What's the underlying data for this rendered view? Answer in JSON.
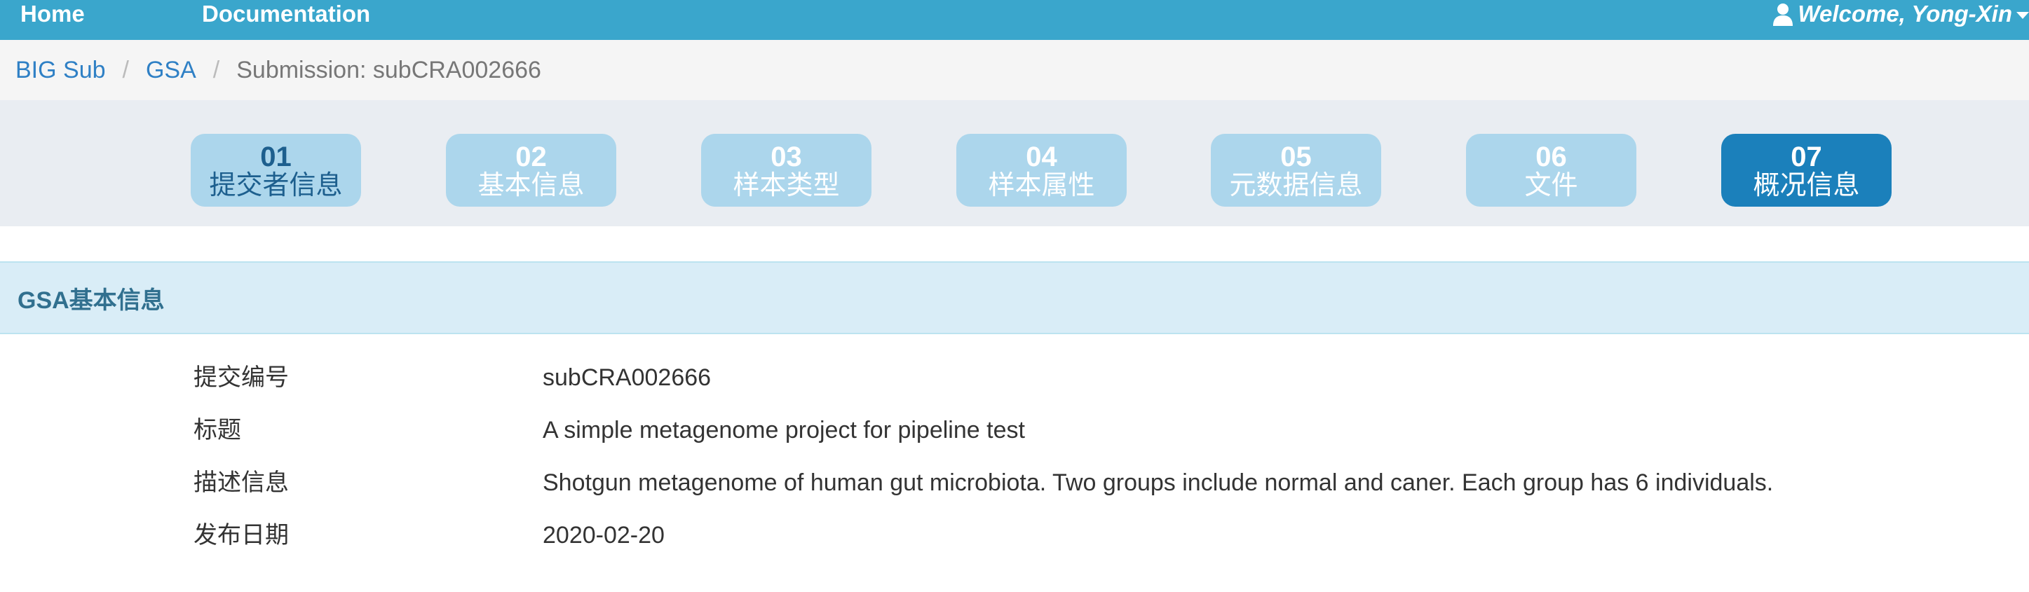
{
  "navbar": {
    "home": "Home",
    "documentation": "Documentation",
    "welcome": "Welcome, Yong-Xin"
  },
  "breadcrumb": {
    "items": [
      "BIG Sub",
      "GSA"
    ],
    "active": "Submission: subCRA002666",
    "separator": "/"
  },
  "steps": [
    {
      "num": "01",
      "label": "提交者信息"
    },
    {
      "num": "02",
      "label": "基本信息"
    },
    {
      "num": "03",
      "label": "样本类型"
    },
    {
      "num": "04",
      "label": "样本属性"
    },
    {
      "num": "05",
      "label": "元数据信息"
    },
    {
      "num": "06",
      "label": "文件"
    },
    {
      "num": "07",
      "label": "概况信息"
    }
  ],
  "active_step": "07",
  "panel": {
    "title": "GSA基本信息"
  },
  "info": [
    {
      "label": "提交编号",
      "value": "subCRA002666"
    },
    {
      "label": "标题",
      "value": "A simple metagenome project for pipeline test"
    },
    {
      "label": "描述信息",
      "value": "Shotgun metagenome of human gut microbiota. Two groups include normal and caner. Each group has 6 individuals."
    },
    {
      "label": "发布日期",
      "value": "2020-02-20"
    }
  ],
  "colors": {
    "navbar": "#3aa6cc",
    "step_inactive": "#acd6ec",
    "step_active": "#1b80bb",
    "panel_header": "#d9edf7",
    "link": "#2f80c5"
  }
}
